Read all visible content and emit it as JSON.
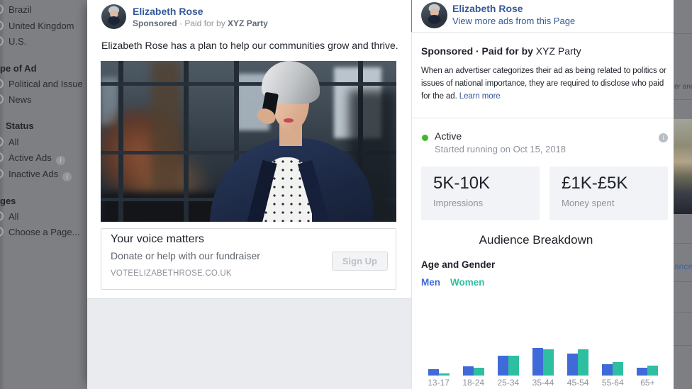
{
  "colors": {
    "accent_blue": "#365899",
    "active_green": "#42b72a",
    "men": "#3f6ad8",
    "women": "#2dbfa0"
  },
  "sidebar": {
    "sections": [
      {
        "header": "",
        "items": [
          "Brazil",
          "United Kingdom",
          "U.S."
        ]
      },
      {
        "header": "pe of Ad",
        "items": [
          "Political and Issue",
          "News"
        ]
      },
      {
        "header": "Status",
        "items": [
          "All",
          "Active Ads",
          "Inactive Ads"
        ]
      },
      {
        "header": "ges",
        "items": [
          "All",
          "Choose a Page..."
        ]
      }
    ]
  },
  "ad_card": {
    "page_name": "Elizabeth Rose",
    "sponsored": "Sponsored",
    "meta_mid": " · Paid for by ",
    "funder": "XYZ Party",
    "body_text": "Elizabeth Rose has a plan to help our communities grow and thrive.",
    "image_alt": "Woman with short grey hair talking on a mobile phone in front of office windows",
    "link_title": "Your voice matters",
    "link_description": "Donate or help with our fundraiser",
    "link_domain": "VOTEELIZABETHROSE.CO.UK",
    "cta_label": "Sign Up"
  },
  "details": {
    "page_name": "Elizabeth Rose",
    "view_more": "View more ads from this Page",
    "sponsor_bold": "Sponsored · Paid for by",
    "funder": "XYZ Party",
    "disclosure": "When an advertiser categorizes their ad as being related to politics or issues of national importance, they are required to disclose who paid for the ad.",
    "learn_more": "Learn more",
    "status": "Active",
    "started": "Started running on Oct 15, 2018",
    "stats": [
      {
        "value": "5K-10K",
        "label": "Impressions"
      },
      {
        "value": "£1K-£5K",
        "label": "Money spent"
      }
    ],
    "audience_title": "Audience Breakdown",
    "age_gender_label": "Age and Gender"
  },
  "background_fragments": {
    "top_text": "er and",
    "link_text": "ance"
  },
  "chart_data": {
    "type": "bar",
    "title": "Age and Gender",
    "categories": [
      "13-17",
      "18-24",
      "25-34",
      "35-44",
      "45-54",
      "55-64",
      "65+"
    ],
    "series": [
      {
        "name": "Men",
        "color": "#3f6ad8",
        "values": [
          9,
          13,
          28,
          39,
          31,
          16,
          11
        ]
      },
      {
        "name": "Women",
        "color": "#2dbfa0",
        "values": [
          3,
          11,
          28,
          37,
          37,
          19,
          14
        ]
      }
    ],
    "unit": "relative bar height (y-axis unlabeled in UI)",
    "legend_position": "top-left",
    "grid": false
  }
}
